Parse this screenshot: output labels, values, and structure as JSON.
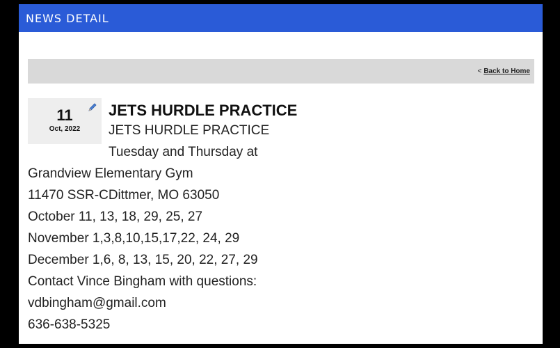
{
  "header": {
    "title": "NEWS DETAIL"
  },
  "toolbar": {
    "back_prefix": "<",
    "back_label": "Back to Home"
  },
  "post": {
    "day": "11",
    "month_year": "Oct, 2022",
    "edit_icon": "pencil-icon",
    "title": "JETS HURDLE PRACTICE",
    "lines": [
      "JETS HURDLE PRACTICE",
      "Tuesday and Thursday at",
      "Grandview Elementary Gym",
      "11470 SSR-CDittmer, MO  63050",
      "October 11, 13, 18, 29, 25, 27",
      "November 1,3,8,10,15,17,22, 24, 29",
      "December 1,6, 8, 13, 15, 20, 22, 27, 29",
      "Contact Vince Bingham with questions:",
      "vdbingham@gmail.com",
      "636-638-5325"
    ]
  },
  "colors": {
    "header_bg": "#2a5bd7",
    "toolbar_bg": "#d9d9d9",
    "date_bg": "#eeeeee"
  }
}
